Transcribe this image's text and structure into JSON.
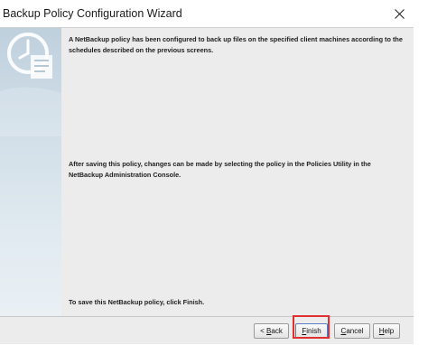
{
  "window": {
    "title": "Backup Policy Configuration Wizard",
    "close_icon": "close-icon"
  },
  "content": {
    "paragraph_1": "A NetBackup policy has been configured to back up files on the specified client machines according to the schedules described on the previous screens.",
    "paragraph_2": "After saving this policy, changes can be made by selecting the policy in the Policies Utility in the NetBackup Administration Console.",
    "paragraph_3": "To save this NetBackup policy, click Finish."
  },
  "buttons": {
    "back": {
      "prefix": "< ",
      "mnemonic": "B",
      "rest": "ack"
    },
    "finish": {
      "mnemonic": "F",
      "rest": "inish"
    },
    "cancel": {
      "mnemonic": "C",
      "rest": "ancel"
    },
    "help": {
      "mnemonic": "H",
      "rest": "elp"
    }
  },
  "colors": {
    "highlight": "#e03030",
    "banner": "#c9d8e3"
  }
}
